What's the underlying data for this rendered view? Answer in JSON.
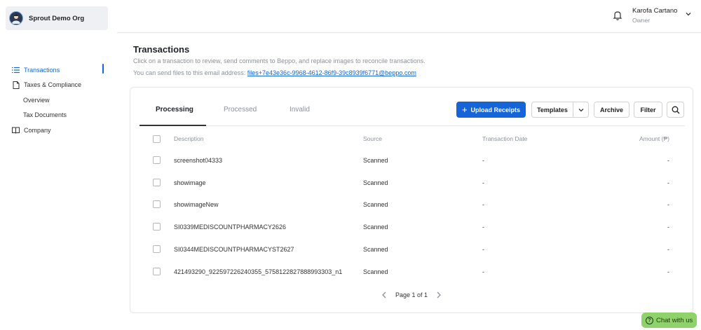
{
  "org": {
    "name": "Sprout Demo Org",
    "avatar_icon": "user-avatar-icon"
  },
  "sidebar": {
    "items": [
      {
        "label": "Transactions",
        "icon": "list-icon",
        "active": true
      },
      {
        "label": "Taxes & Compliance",
        "icon": "document-icon"
      },
      {
        "label": "Overview",
        "sub": true
      },
      {
        "label": "Tax Documents",
        "sub": true
      },
      {
        "label": "Company",
        "icon": "book-icon"
      }
    ]
  },
  "header": {
    "user_name": "Karofa Cartano",
    "user_role": "Owner"
  },
  "page": {
    "title": "Transactions",
    "subtitle": "Click on a transaction to review, send comments to Beppo, and replace images to reconcile transactions.",
    "email_prefix": "You can send files to this email address: ",
    "email": "files+7e43e36c-9968-4612-86f9-39c8939f6771@beppo.com"
  },
  "tabs": [
    {
      "label": "Processing",
      "active": true
    },
    {
      "label": "Processed"
    },
    {
      "label": "Invalid"
    }
  ],
  "toolbar": {
    "upload_label": "Upload Receipts",
    "templates_label": "Templates",
    "archive_label": "Archive",
    "filter_label": "Filter"
  },
  "table": {
    "columns": [
      "Description",
      "Source",
      "Transaction Date",
      "Amount (₱)"
    ],
    "rows": [
      {
        "description": "screenshot04333",
        "source": "Scanned",
        "date": "-",
        "amount": "-"
      },
      {
        "description": "showimage",
        "source": "Scanned",
        "date": "-",
        "amount": "-"
      },
      {
        "description": "showimageNew",
        "source": "Scanned",
        "date": "-",
        "amount": "-"
      },
      {
        "description": "SI0339MEDISCOUNTPHARMACY2626",
        "source": "Scanned",
        "date": "-",
        "amount": "-"
      },
      {
        "description": "SI0344MEDISCOUNTPHARMACYST2627",
        "source": "Scanned",
        "date": "-",
        "amount": "-"
      },
      {
        "description": "421493290_922597226240355_5758122827888993303_n1",
        "source": "Scanned",
        "date": "-",
        "amount": "-"
      }
    ]
  },
  "pagination": {
    "label": "Page 1 of 1"
  },
  "chat": {
    "label": "Chat with us"
  },
  "colors": {
    "accent": "#1565d8",
    "chat": "#8fd16a"
  }
}
